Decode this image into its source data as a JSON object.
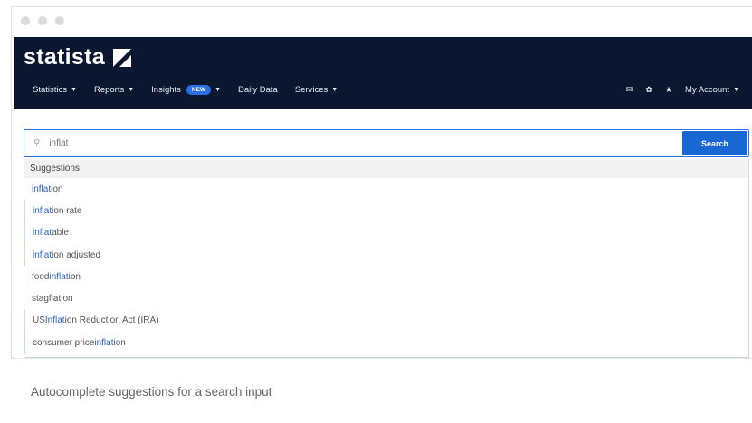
{
  "window": {
    "controls": [
      "close",
      "minimize",
      "maximize"
    ]
  },
  "header": {
    "logo_text": "statista",
    "nav": [
      {
        "label": "Statistics",
        "has_dropdown": true
      },
      {
        "label": "Reports",
        "has_dropdown": true
      },
      {
        "label": "Insights",
        "badge": "NEW",
        "has_dropdown": true
      },
      {
        "label": "Daily Data",
        "has_dropdown": false
      },
      {
        "label": "Services",
        "has_dropdown": true
      }
    ],
    "right_icons": [
      "mail-icon",
      "settings-icon",
      "star-icon"
    ],
    "account_label": "My Account"
  },
  "search": {
    "value": "inflat",
    "button_label": "Search"
  },
  "suggestions": {
    "header": "Suggestions",
    "items": [
      {
        "before": "",
        "match": "inflat",
        "after": "ion"
      },
      {
        "before": "",
        "match": "inflat",
        "after": "ion rate"
      },
      {
        "before": "",
        "match": "inflat",
        "after": "able"
      },
      {
        "before": "",
        "match": "inflat",
        "after": "ion adjusted"
      },
      {
        "before": "food ",
        "match": "inflat",
        "after": "ion"
      },
      {
        "before": "stagflation",
        "match": "",
        "after": ""
      },
      {
        "before": "US ",
        "match": "Inflat",
        "after": "ion Reduction Act (IRA)"
      },
      {
        "before": "consumer price ",
        "match": "inflat",
        "after": "ion"
      }
    ]
  },
  "caption": "Autocomplete suggestions for a search input",
  "colors": {
    "navbar": "#0b1730",
    "accent": "#1967d2",
    "badge": "#2a6fe3"
  }
}
